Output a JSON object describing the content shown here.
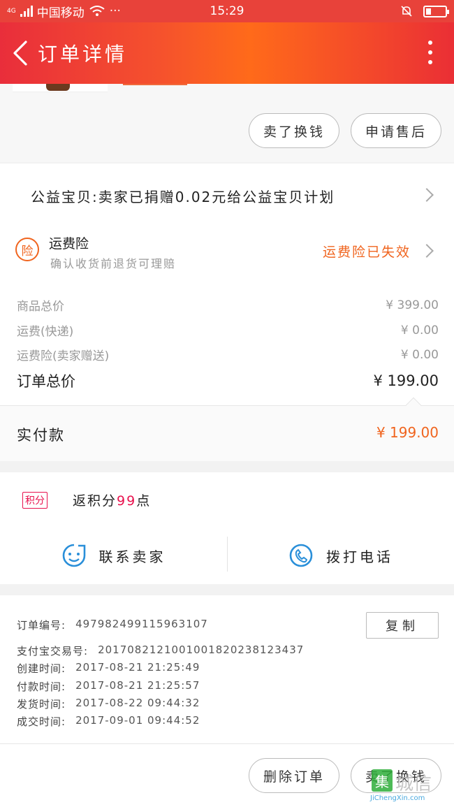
{
  "status_bar": {
    "carrier": "中国移动",
    "network": "4G",
    "dots": "···",
    "time": "15:29"
  },
  "nav": {
    "title": "订单详情"
  },
  "actions_top": {
    "buy_again": "卖了换钱",
    "after_sale": "申请售后"
  },
  "charity": {
    "text": "公益宝贝:卖家已捐赠0.02元给公益宝贝计划"
  },
  "insurance": {
    "badge": "险",
    "title": "运费险",
    "subtitle": "确认收货前退货可理赔",
    "status": "运费险已失效"
  },
  "prices": [
    {
      "label": "商品总价",
      "value": "¥ 399.00"
    },
    {
      "label": "运费(快递)",
      "value": "¥ 0.00"
    },
    {
      "label": "运费险(卖家赠送)",
      "value": "¥ 0.00"
    }
  ],
  "order_total": {
    "label": "订单总价",
    "value": "¥ 199.00"
  },
  "paid": {
    "label": "实付款",
    "value": "¥ 199.00"
  },
  "points": {
    "badge": "积分",
    "prefix": "返积分",
    "amount": "99",
    "suffix": "点"
  },
  "contact": {
    "chat": "联系卖家",
    "call": "拨打电话"
  },
  "order_info": {
    "copy": "复制",
    "rows": [
      {
        "label": "订单编号:",
        "value": "497982499115963107"
      },
      {
        "label": "支付宝交易号:",
        "value": "2017082121001001820238123437"
      },
      {
        "label": "创建时间:",
        "value": "2017-08-21 21:25:49"
      },
      {
        "label": "付款时间:",
        "value": "2017-08-21 21:25:57"
      },
      {
        "label": "发货时间:",
        "value": "2017-08-22 09:44:32"
      },
      {
        "label": "成交时间:",
        "value": "2017-09-01 09:44:52"
      }
    ]
  },
  "actions_bottom": {
    "delete": "删除订单",
    "sell": "卖了换钱"
  },
  "watermark": {
    "text": "城信",
    "url": "JiChengXin.com"
  },
  "colors": {
    "accent": "#f0641e",
    "nav_gradient_start": "#e92e3b",
    "nav_gradient_mid": "#ff6a1a",
    "points_red": "#e8114d"
  }
}
